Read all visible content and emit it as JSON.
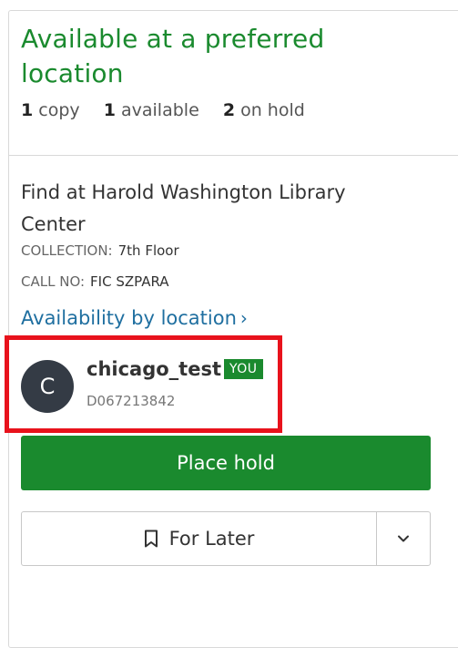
{
  "availability": {
    "title": "Available at a preferred location",
    "copies_num": "1",
    "copies_label": "copy",
    "available_num": "1",
    "available_label": "available",
    "holds_num": "2",
    "holds_label": "on hold"
  },
  "location": {
    "find_at": "Find at Harold Washington Library Center",
    "collection_key": "COLLECTION:",
    "collection_value": "7th Floor",
    "callno_key": "CALL NO:",
    "callno_value": "FIC SZPARA",
    "availability_link": "Availability by location"
  },
  "user": {
    "avatar_initial": "C",
    "username": "chicago_test",
    "badge": "YOU",
    "barcode": "D067213842"
  },
  "actions": {
    "place_hold": "Place hold",
    "for_later": "For Later"
  },
  "colors": {
    "accent_green": "#1a8a2e",
    "link_blue": "#1f6fa0",
    "highlight_red": "#e8121c"
  },
  "icons": [
    "chevron-right-icon",
    "bookmark-icon",
    "chevron-down-icon"
  ]
}
